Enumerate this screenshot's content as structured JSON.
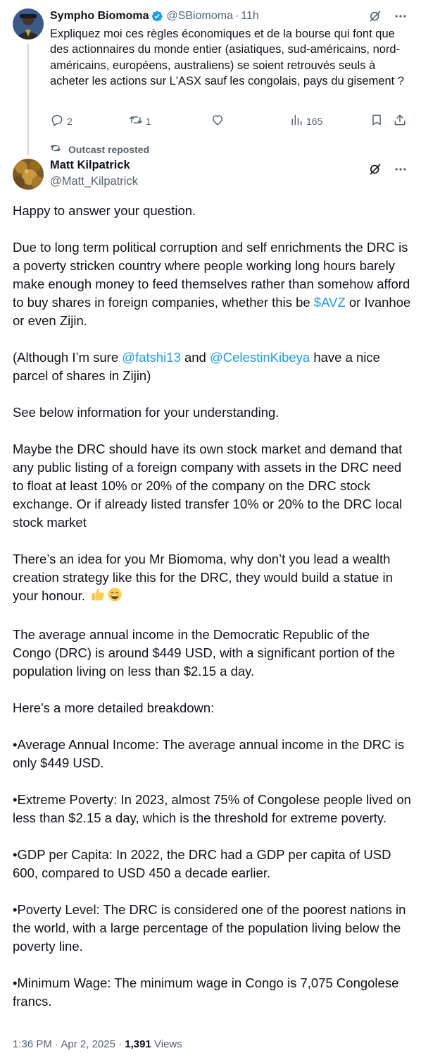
{
  "parent_tweet": {
    "author_name": "Sympho Biomoma",
    "handle": "@SBiomoma",
    "separator": "·",
    "time": "11h",
    "text": "Expliquez moi ces règles économiques et de la bourse qui font que des actionnaires du monde entier (asiatiques, sud-américains, nord-américains, européens, australiens) se soient retrouvés seuls à acheter les actions sur L'ASX sauf les congolais, pays du gisement ?",
    "stats": {
      "replies": "2",
      "reposts": "1",
      "likes": "",
      "views": "165"
    }
  },
  "repost_indicator": {
    "label": "Outcast reposted"
  },
  "main_tweet": {
    "author_name": "Matt Kilpatrick",
    "handle": "@Matt_Kilpatrick",
    "paragraphs": {
      "p1": "Happy to answer your question.",
      "p2_before": "Due to long term political corruption and self enrichments the DRC is a poverty stricken country where people working long hours barely make enough money to feed themselves rather than somehow afford to buy shares in foreign companies, whether this be ",
      "p2_link": "$AVZ",
      "p2_after": " or Ivanhoe or even Zijin.",
      "p3_before": "(Although I’m sure ",
      "p3_link1": "@fatshi13",
      "p3_mid": " and ",
      "p3_link2": "@CelestinKibeya",
      "p3_after": " have a nice parcel of shares in Zijin)",
      "p4": "See below information for your understanding.",
      "p5": "Maybe the DRC should have its own stock market and demand that any public listing of a foreign company with assets in the DRC need to float at least 10% or 20% of the company on the DRC stock exchange. Or if already listed transfer 10% or 20% to the DRC local stock market",
      "p6": "There’s an idea for you Mr Biomoma, why don’t you lead a wealth creation strategy like this for the DRC, they would build a statue in your honour. ",
      "p7": "The average annual income in the Democratic Republic of the Congo (DRC) is around $449 USD, with a significant portion of the population living on less than $2.15 a day.",
      "p8": "Here's a more detailed breakdown:",
      "p9": "•Average Annual Income: The average annual income in the DRC is only $449 USD.",
      "p10": "•Extreme Poverty: In 2023, almost 75% of Congolese people lived on less than $2.15 a day, which is the threshold for extreme poverty.",
      "p11": "•GDP per Capita: In 2022, the DRC had a GDP per capita of USD 600, compared to USD 450 a decade earlier.",
      "p12": "•Poverty Level: The DRC is considered one of the poorest nations in the world, with a large percentage of the population living below the poverty line.",
      "p13": "•Minimum Wage: The minimum wage in Congo is 7,075 Congolese francs."
    },
    "meta": {
      "time": "1:36 PM",
      "separator": "·",
      "date": "Apr 2, 2025",
      "views_count": "1,391",
      "views_label": "Views"
    }
  },
  "colors": {
    "text_primary": "#0f1419",
    "text_secondary": "#536471",
    "link": "#1d9bf0",
    "verified_badge": "#1d9bf0",
    "thread_line": "#cfd9de"
  },
  "icons": {
    "verified": "verified-badge-icon",
    "grok": "grok-icon",
    "more": "more-icon",
    "reply": "reply-icon",
    "repost": "repost-icon",
    "like": "heart-icon",
    "views": "views-icon",
    "bookmark": "bookmark-icon",
    "share": "share-icon",
    "emoji_1": "thumbs-up-emoji",
    "emoji_2": "grinning-face-emoji"
  }
}
